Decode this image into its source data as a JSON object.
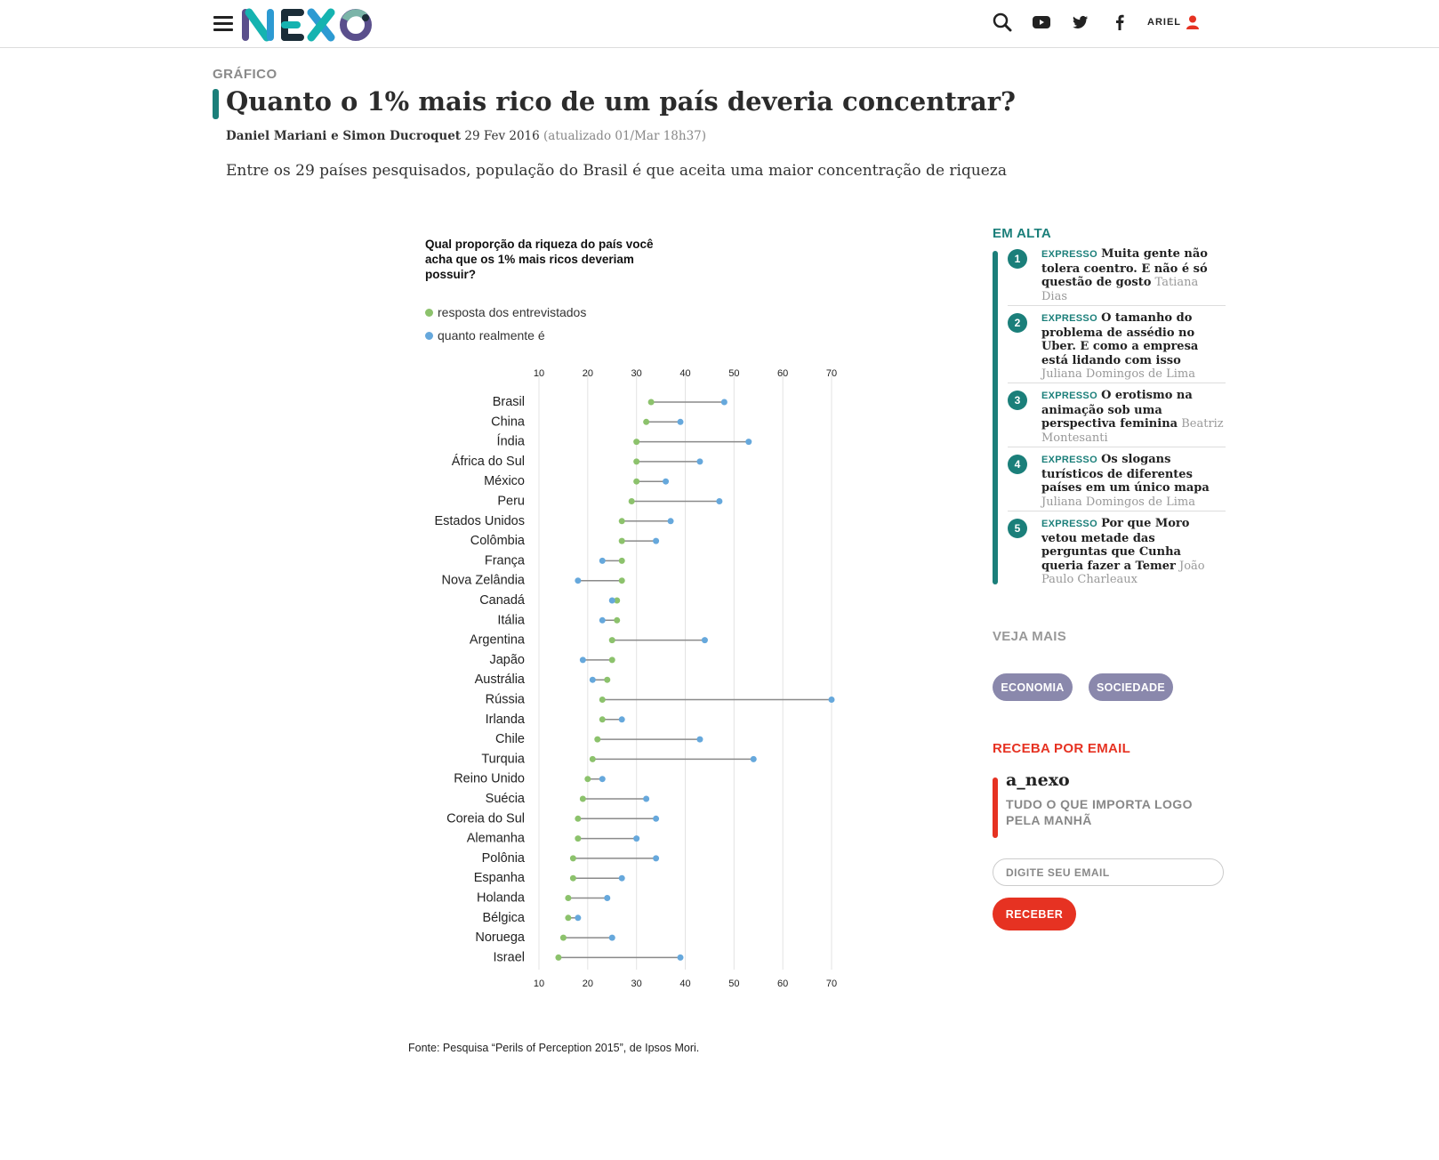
{
  "header": {
    "logo_text": "NEXO",
    "user_label": "ARIEL",
    "icons": [
      "menu-icon",
      "search-icon",
      "youtube-icon",
      "twitter-icon",
      "facebook-icon",
      "user-icon"
    ]
  },
  "article": {
    "kicker": "GRÁFICO",
    "title": "Quanto o 1% mais rico de um país deveria concentrar?",
    "authors": "Daniel Mariani e Simon Ducroquet",
    "date": "29 Fev 2016",
    "updated": "(atualizado 01/Mar 18h37)",
    "standfirst": "Entre os 29 países pesquisados, população do Brasil é que aceita uma maior concentração de riqueza"
  },
  "chart_data": {
    "type": "dumbbell",
    "title": "Qual proporção da riqueza do país você acha que os 1% mais ricos deveriam possuir?",
    "x_ticks": [
      10,
      20,
      30,
      40,
      50,
      60,
      70
    ],
    "xlim": [
      10,
      70
    ],
    "grid": true,
    "legend_position": "top-left",
    "series": [
      {
        "name": "resposta dos entrevistados",
        "color": "#8cc26c",
        "key": "ideal"
      },
      {
        "name": "quanto realmente é",
        "color": "#66a8dc",
        "key": "actual"
      }
    ],
    "rows": [
      {
        "country": "Brasil",
        "ideal": 33,
        "actual": 48
      },
      {
        "country": "China",
        "ideal": 32,
        "actual": 39
      },
      {
        "country": "Índia",
        "ideal": 30,
        "actual": 53
      },
      {
        "country": "África do Sul",
        "ideal": 30,
        "actual": 43
      },
      {
        "country": "México",
        "ideal": 30,
        "actual": 36
      },
      {
        "country": "Peru",
        "ideal": 29,
        "actual": 47
      },
      {
        "country": "Estados Unidos",
        "ideal": 27,
        "actual": 37
      },
      {
        "country": "Colômbia",
        "ideal": 27,
        "actual": 34
      },
      {
        "country": "França",
        "ideal": 27,
        "actual": 23
      },
      {
        "country": "Nova Zelândia",
        "ideal": 27,
        "actual": 18
      },
      {
        "country": "Canadá",
        "ideal": 26,
        "actual": 25
      },
      {
        "country": "Itália",
        "ideal": 26,
        "actual": 23
      },
      {
        "country": "Argentina",
        "ideal": 25,
        "actual": 44
      },
      {
        "country": "Japão",
        "ideal": 25,
        "actual": 19
      },
      {
        "country": "Austrália",
        "ideal": 24,
        "actual": 21
      },
      {
        "country": "Rússia",
        "ideal": 23,
        "actual": 70
      },
      {
        "country": "Irlanda",
        "ideal": 23,
        "actual": 27
      },
      {
        "country": "Chile",
        "ideal": 22,
        "actual": 43
      },
      {
        "country": "Turquia",
        "ideal": 21,
        "actual": 54
      },
      {
        "country": "Reino Unido",
        "ideal": 20,
        "actual": 23
      },
      {
        "country": "Suécia",
        "ideal": 19,
        "actual": 32
      },
      {
        "country": "Coreia do Sul",
        "ideal": 18,
        "actual": 34
      },
      {
        "country": "Alemanha",
        "ideal": 18,
        "actual": 30
      },
      {
        "country": "Polônia",
        "ideal": 17,
        "actual": 34
      },
      {
        "country": "Espanha",
        "ideal": 17,
        "actual": 27
      },
      {
        "country": "Holanda",
        "ideal": 16,
        "actual": 24
      },
      {
        "country": "Bélgica",
        "ideal": 16,
        "actual": 18
      },
      {
        "country": "Noruega",
        "ideal": 15,
        "actual": 25
      },
      {
        "country": "Israel",
        "ideal": 14,
        "actual": 39
      }
    ],
    "source": "Fonte: Pesquisa “Perils of Perception 2015”, de Ipsos Mori."
  },
  "sidebar": {
    "trending_heading": "EM ALTA",
    "trending": [
      {
        "num": "1",
        "tag": "EXPRESSO",
        "title": "Muita gente não tolera coentro. E não é só questão de gosto",
        "author": "Tatiana Dias"
      },
      {
        "num": "2",
        "tag": "EXPRESSO",
        "title": "O tamanho do problema de assédio no Uber. E como a empresa está lidando com isso",
        "author": "Juliana Domingos de Lima"
      },
      {
        "num": "3",
        "tag": "EXPRESSO",
        "title": "O erotismo na animação sob uma perspectiva feminina",
        "author": "Beatriz Montesanti"
      },
      {
        "num": "4",
        "tag": "EXPRESSO",
        "title": "Os slogans turísticos de diferentes países em um único mapa",
        "author": "Juliana Domingos de Lima"
      },
      {
        "num": "5",
        "tag": "EXPRESSO",
        "title": "Por que Moro vetou metade das perguntas que Cunha queria fazer a Temer",
        "author": "João Paulo Charleaux"
      }
    ],
    "more_heading": "VEJA MAIS",
    "tags": [
      "ECONOMIA",
      "SOCIEDADE"
    ],
    "newsletter_heading": "RECEBA POR EMAIL",
    "newsletter_name": "a_nexo",
    "newsletter_desc": "TUDO O QUE IMPORTA LOGO PELA MANHÃ",
    "email_placeholder": "DIGITE SEU EMAIL",
    "submit_label": "RECEBER"
  },
  "colors": {
    "brand_teal": "#1b7f7a",
    "accent_red": "#e63222",
    "tag_purple": "#8a88ac",
    "ideal_green": "#8cc26c",
    "actual_blue": "#66a8dc"
  }
}
